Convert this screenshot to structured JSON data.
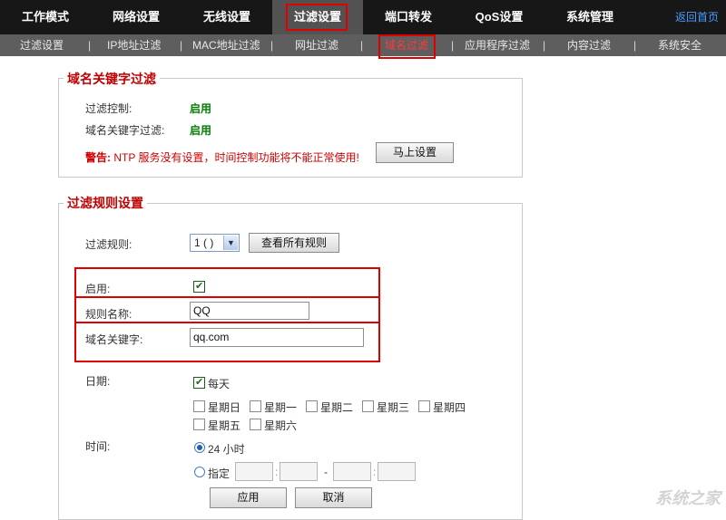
{
  "topnav": {
    "tabs": [
      "工作模式",
      "网络设置",
      "无线设置",
      "过滤设置",
      "端口转发",
      "QoS设置",
      "系统管理"
    ],
    "back_home": "返回首页"
  },
  "subnav": {
    "items": [
      "过滤设置",
      "IP地址过滤",
      "MAC地址过滤",
      "网址过滤",
      "域名过滤",
      "应用程序过滤",
      "内容过滤",
      "系统安全"
    ],
    "separator": "|"
  },
  "keyword_filter": {
    "legend": "域名关键字过滤",
    "filter_control_label": "过滤控制:",
    "filter_control_value": "启用",
    "keyword_filter_label": "域名关键字过滤:",
    "keyword_filter_value": "启用",
    "warning_prefix": "警告:",
    "warning_text": " NTP 服务没有设置，时间控制功能将不能正常使用!",
    "set_now_button": "马上设置"
  },
  "rule_settings": {
    "legend": "过滤规则设置",
    "rule_label": "过滤规则:",
    "rule_selected": "1 ( )",
    "view_all_button": "查看所有规则",
    "enable_label": "启用:",
    "enable_checked": true,
    "rule_name_label": "规则名称:",
    "rule_name_value": "QQ",
    "domain_keyword_label": "域名关键字:",
    "domain_keyword_value": "qq.com",
    "date_label": "日期:",
    "everyday_label": "每天",
    "days": [
      "星期日",
      "星期一",
      "星期二",
      "星期三",
      "星期四",
      "星期五",
      "星期六"
    ],
    "time_label": "时间:",
    "time_24h_label": "24 小时",
    "time_specified_label": "指定",
    "time_colon": ":",
    "time_dash": "-",
    "apply_button": "应用",
    "cancel_button": "取消"
  },
  "watermark": "系统之家",
  "colors": {
    "nav_bg": "#171717",
    "active_tab_bg": "#525252",
    "subnav_bg": "#5e5e5e",
    "accent_red": "#e00000",
    "enabled_green": "#008000"
  }
}
